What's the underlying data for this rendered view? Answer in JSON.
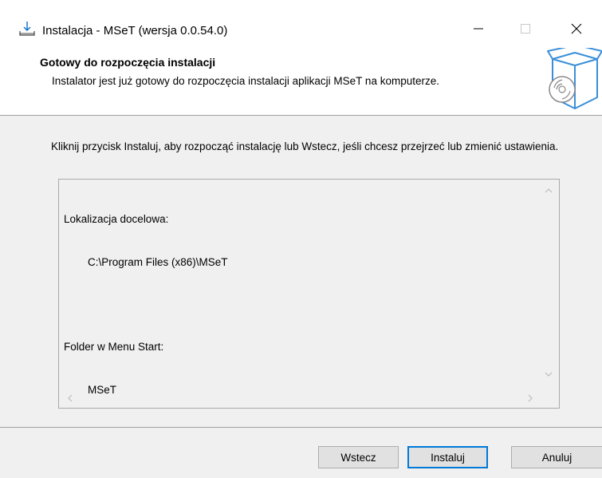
{
  "window": {
    "title": "Instalacja - MSeT (wersja 0.0.54.0)",
    "icons": {
      "app": "download-icon",
      "minimize": "minimize-icon",
      "maximize": "maximize-icon",
      "close": "close-icon"
    }
  },
  "header": {
    "title": "Gotowy do rozpoczęcia instalacji",
    "subtitle": "Instalator jest już gotowy do rozpoczęcia instalacji aplikacji MSeT na komputerze.",
    "image_icon": "software-box-icon"
  },
  "body": {
    "instructions": "Kliknij przycisk Instaluj, aby rozpocząć instalację lub Wstecz, jeśli chcesz przejrzeć lub zmienić ustawienia.",
    "memo": {
      "destination_label": "Lokalizacja docelowa:",
      "destination_value": "C:\\Program Files (x86)\\MSeT",
      "start_menu_label": "Folder w Menu Start:",
      "start_menu_value": "MSeT"
    }
  },
  "buttons": {
    "back": "Wstecz",
    "install": "Instaluj",
    "cancel": "Anuluj"
  },
  "colors": {
    "background": "#f0f0f0",
    "header_bg": "#ffffff",
    "accent": "#0078d7",
    "button_bg": "#e1e1e1"
  }
}
